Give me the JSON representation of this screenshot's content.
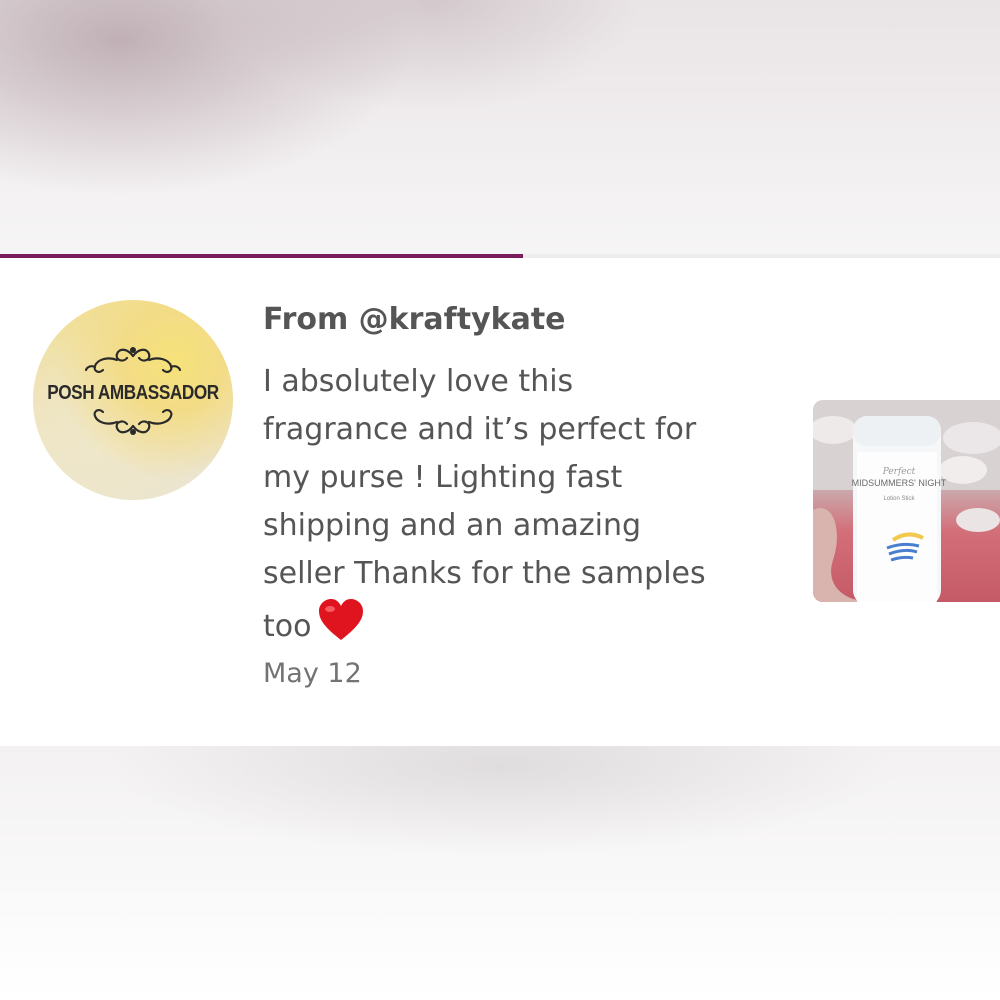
{
  "progress": {
    "fraction": 0.523,
    "color": "#7a1d5c"
  },
  "review": {
    "avatar_label": "POSH AMBASSADOR",
    "from": "From @kraftykate",
    "comment_lines": [
      "I absolutely love this",
      "fragrance and it’s perfect for",
      "my purse ! Lighting fast",
      "shipping and an amazing",
      "seller Thanks for the samples",
      "too"
    ],
    "emoji": "red-heart-icon",
    "date": "May 12"
  },
  "photo": {
    "product_script": "Perfect",
    "product_name": "MIDSUMMERS' NIGHT",
    "product_type": "Lotion Stick"
  }
}
